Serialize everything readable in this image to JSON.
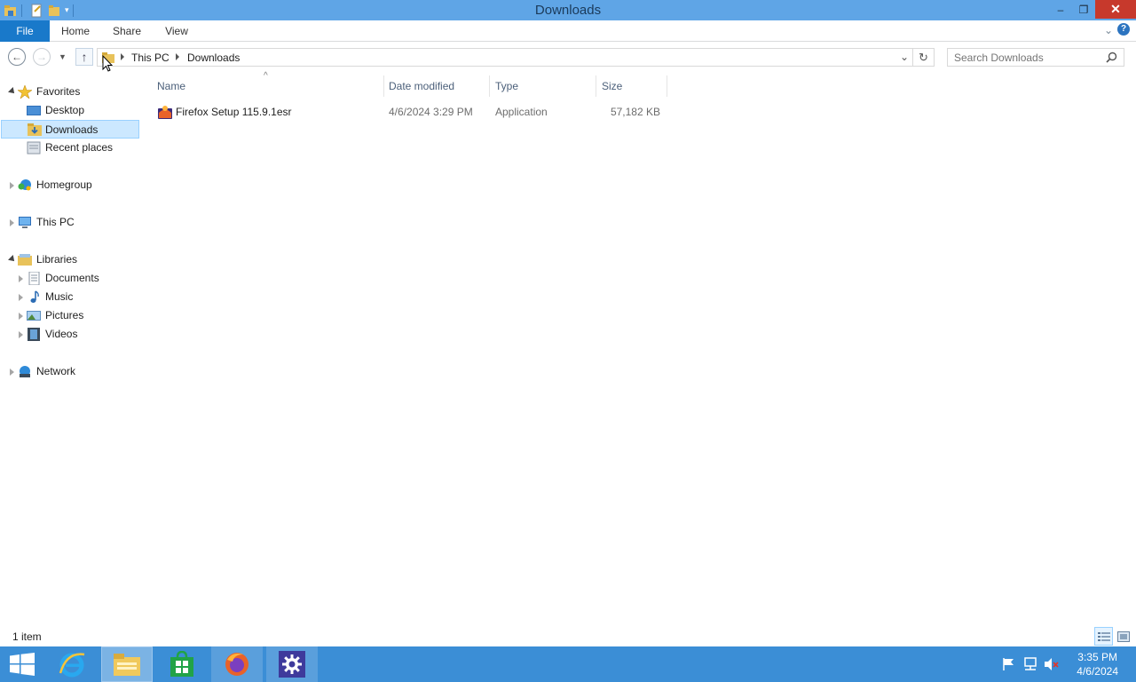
{
  "window": {
    "title": "Downloads",
    "controls": {
      "minimize": "‒",
      "restore": "❐",
      "close": "✕"
    }
  },
  "ribbon": {
    "tabs": [
      "File",
      "Home",
      "Share",
      "View"
    ],
    "help": "?"
  },
  "address": {
    "crumbs": [
      "This PC",
      "Downloads"
    ],
    "search_placeholder": "Search Downloads"
  },
  "nav_pane": {
    "favorites": {
      "label": "Favorites",
      "items": [
        "Desktop",
        "Downloads",
        "Recent places"
      ],
      "selected": "Downloads"
    },
    "homegroup": "Homegroup",
    "this_pc": "This PC",
    "libraries": {
      "label": "Libraries",
      "items": [
        "Documents",
        "Music",
        "Pictures",
        "Videos"
      ]
    },
    "network": "Network"
  },
  "columns": [
    "Name",
    "Date modified",
    "Type",
    "Size"
  ],
  "files": [
    {
      "name": "Firefox Setup 115.9.1esr",
      "date_modified": "4/6/2024 3:29 PM",
      "type": "Application",
      "size": "57,182 KB"
    }
  ],
  "status": {
    "item_count": "1 item"
  },
  "taskbar": {
    "time": "3:35 PM",
    "date": "4/6/2024",
    "apps": [
      "start",
      "internet-explorer",
      "file-explorer",
      "store",
      "firefox",
      "settings"
    ]
  },
  "colors": {
    "titlebar": "#5fa5e6",
    "file_tab": "#1979ca",
    "taskbar": "#3b8ed6",
    "selection": "#cce8ff",
    "close": "#c7392c"
  }
}
